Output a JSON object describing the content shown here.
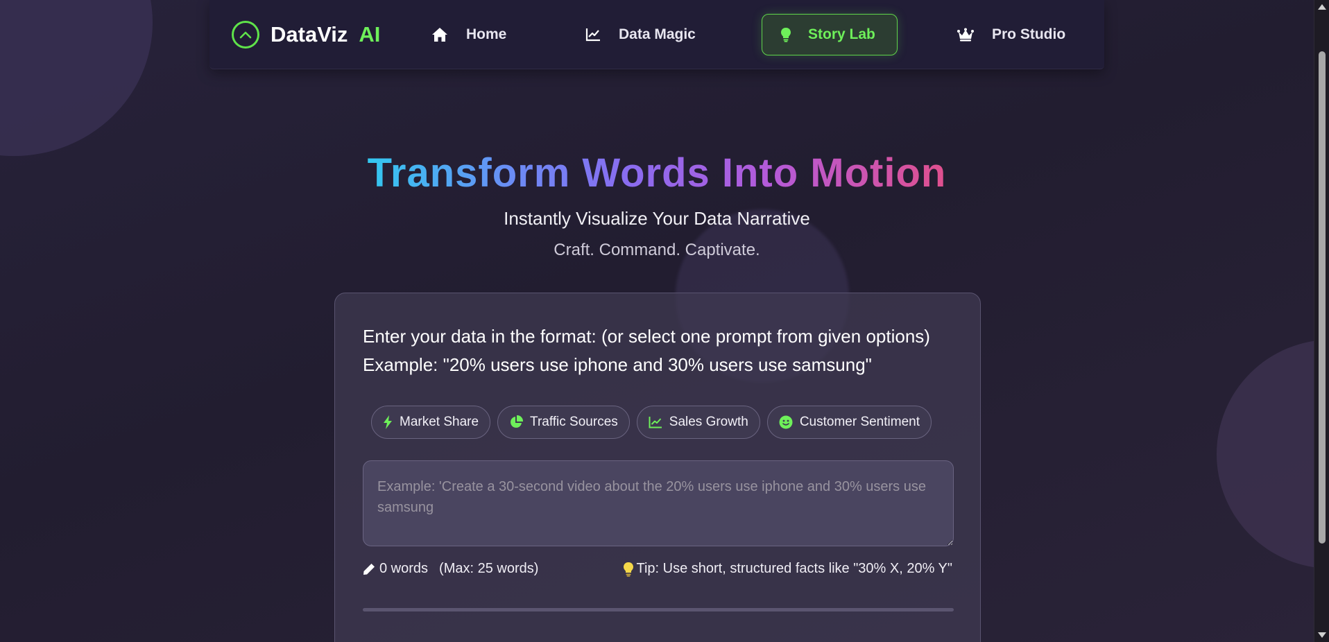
{
  "brand": {
    "name": "DataViz",
    "suffix": "AI"
  },
  "nav": {
    "items": [
      {
        "label": "Home",
        "icon": "home-icon"
      },
      {
        "label": "Data Magic",
        "icon": "line-chart-icon"
      },
      {
        "label": "Story Lab",
        "icon": "lightbulb-icon",
        "active": true
      },
      {
        "label": "Pro Studio",
        "icon": "crown-icon"
      }
    ]
  },
  "hero": {
    "title": "Transform Words Into Motion",
    "subtitle": "Instantly Visualize Your Data Narrative",
    "tagline": "Craft. Command. Captivate."
  },
  "card": {
    "instruction_line1": "Enter your data in the format: (or select one prompt from given options)",
    "instruction_line2": "Example: \"20% users use iphone and 30% users use samsung\"",
    "chips": [
      {
        "label": "Market Share",
        "icon": "bolt-icon"
      },
      {
        "label": "Traffic Sources",
        "icon": "pie-chart-icon"
      },
      {
        "label": "Sales Growth",
        "icon": "line-chart-icon"
      },
      {
        "label": "Customer Sentiment",
        "icon": "smile-icon"
      }
    ],
    "input": {
      "value": "",
      "placeholder": "Example: 'Create a 30-second video about the 20% users use iphone and 30% users use samsung"
    },
    "word_count": "0 words",
    "max_words": "(Max: 25 words)",
    "tip": "Tip: Use short, structured facts like \"30% X, 20% Y\"",
    "progress": 0
  },
  "colors": {
    "accent": "#6ef05a",
    "background": "#241f33",
    "nav_background": "#211d36",
    "card_background": "#403a52"
  }
}
